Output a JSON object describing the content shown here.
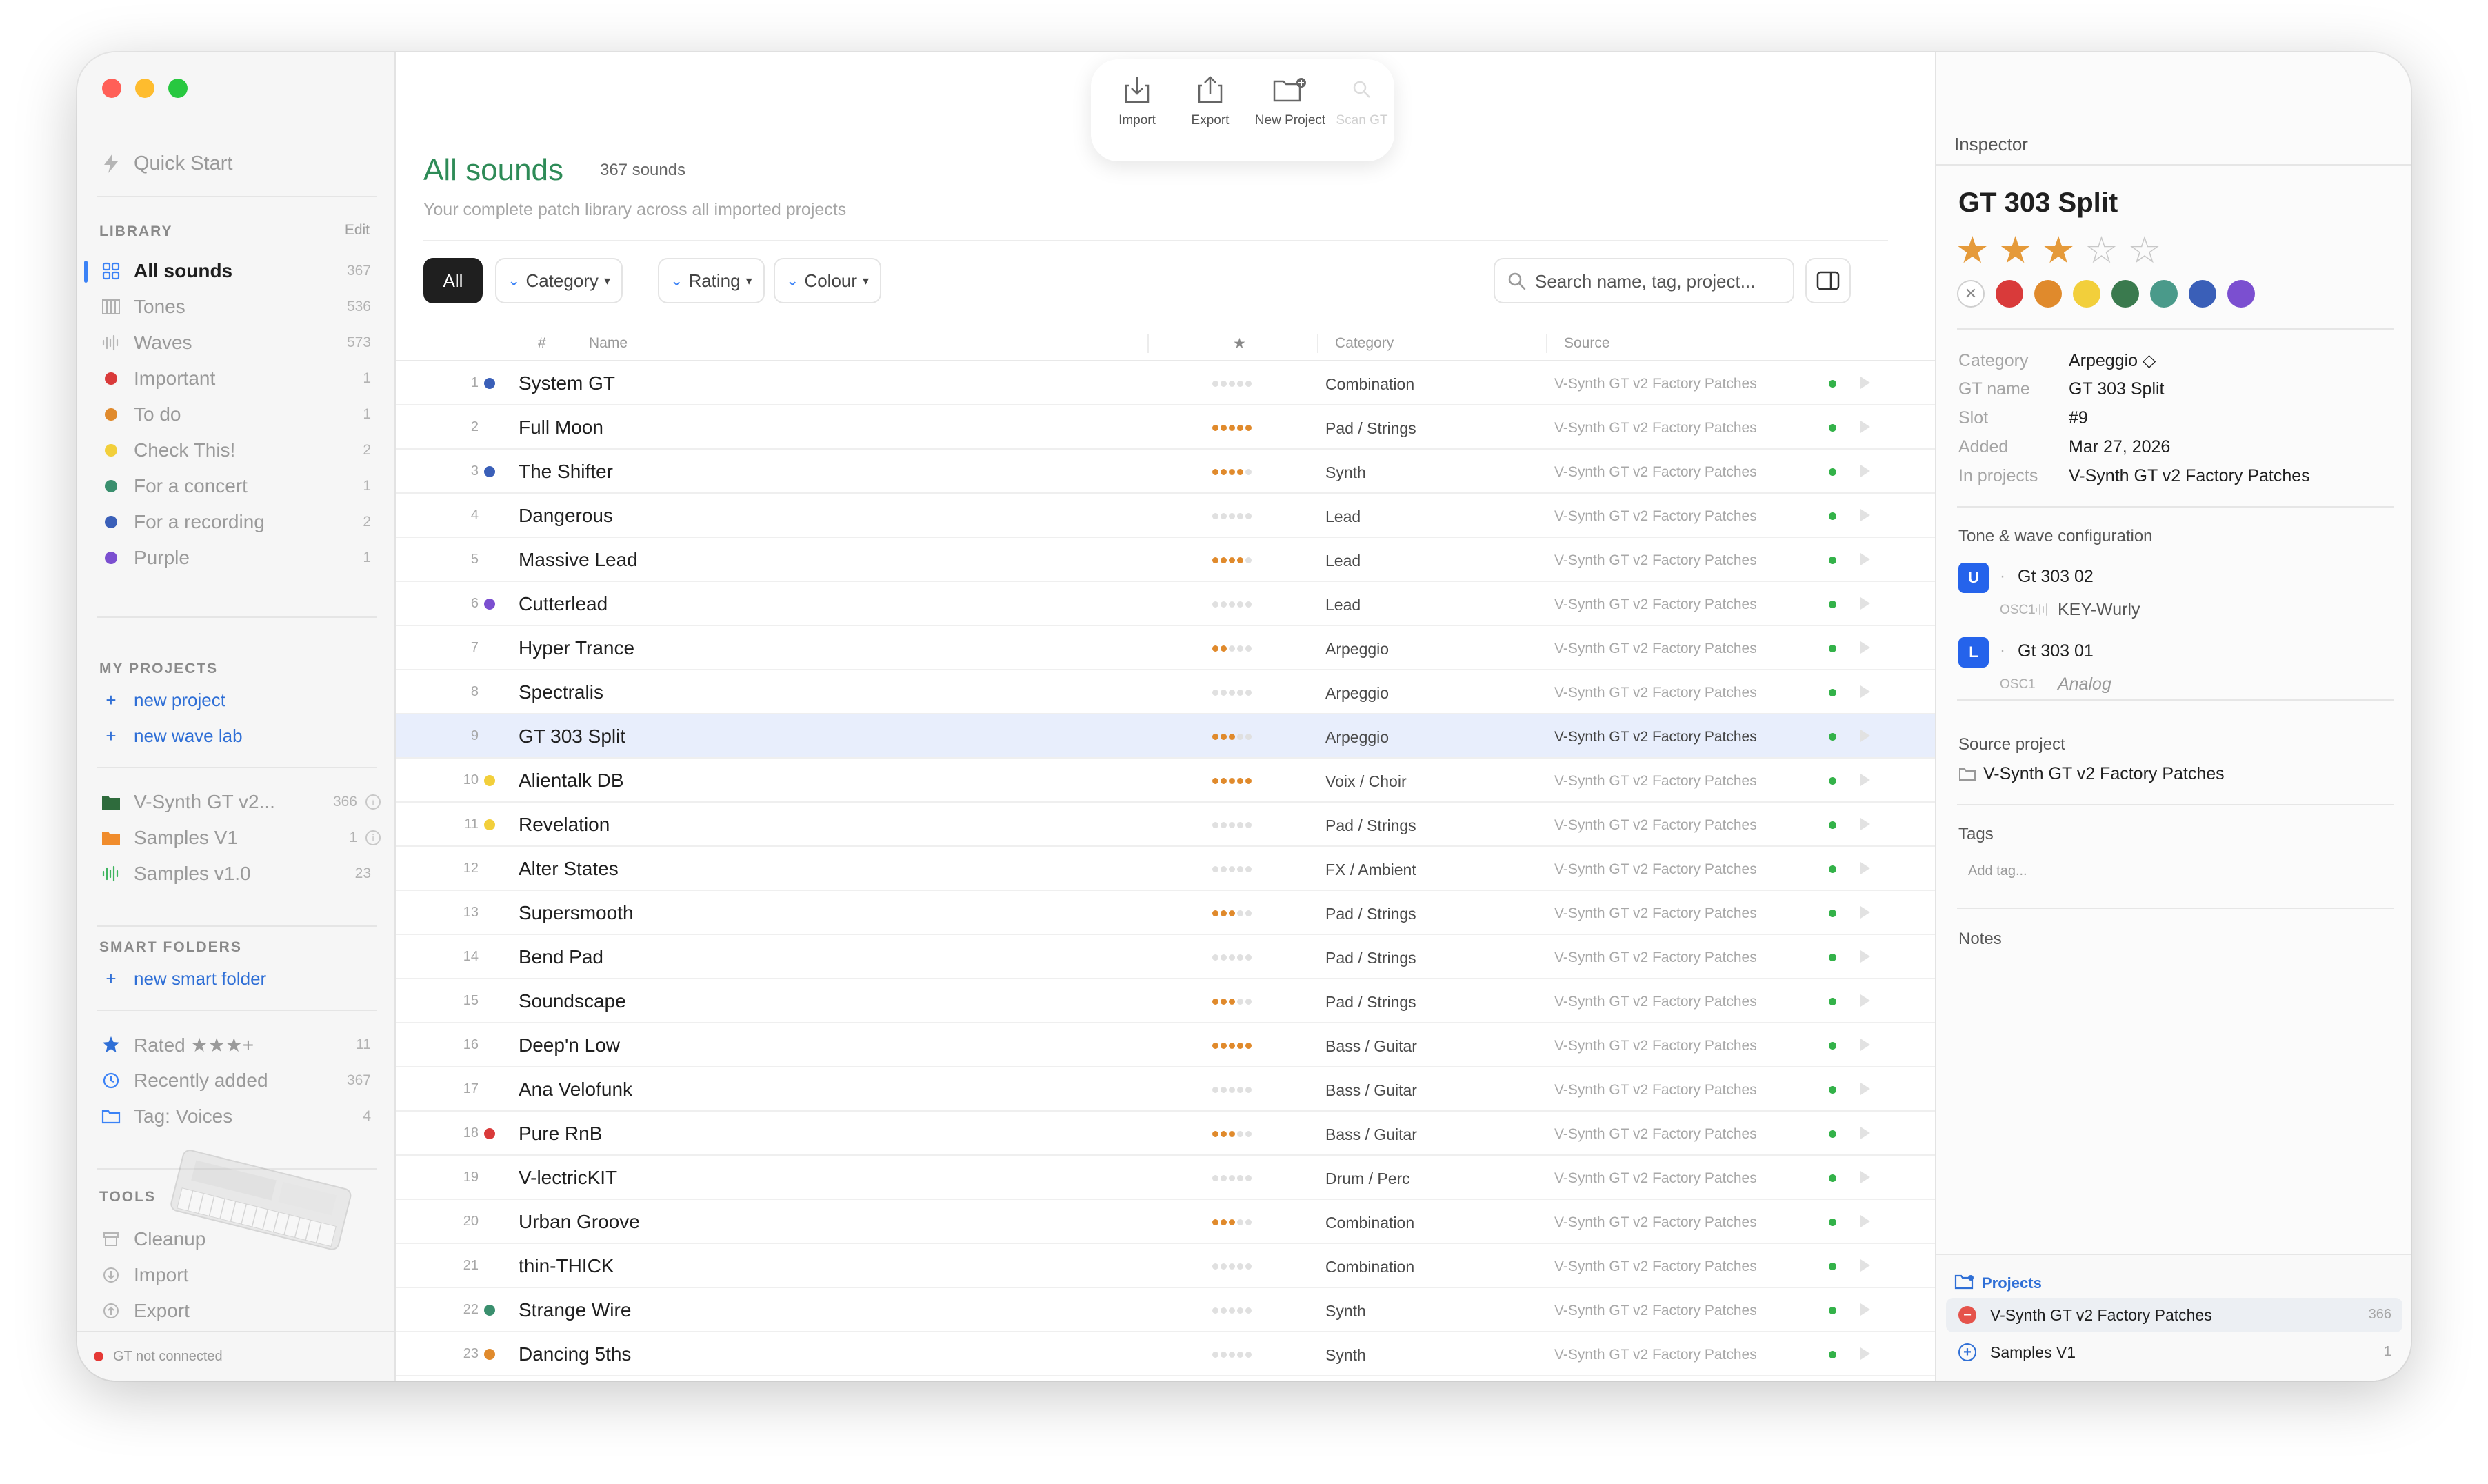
{
  "toolbar": {
    "buttons": [
      {
        "label": "Import",
        "icon": "import-icon"
      },
      {
        "label": "Export",
        "icon": "export-icon"
      },
      {
        "label": "New Project",
        "icon": "new-project-icon"
      },
      {
        "label": "Scan GT",
        "icon": "scan-icon"
      }
    ]
  },
  "sidebar": {
    "quick_start": "Quick Start",
    "library_header": "LIBRARY",
    "library_edit": "Edit",
    "library": [
      {
        "label": "All sounds",
        "count": "367",
        "icon": "grid-icon"
      },
      {
        "label": "Tones",
        "count": "536",
        "icon": "piano-icon"
      },
      {
        "label": "Waves",
        "count": "573",
        "icon": "waveform-icon"
      },
      {
        "label": "Important",
        "count": "1",
        "color": "#d93a3a"
      },
      {
        "label": "To do",
        "count": "1",
        "color": "#e08a2c"
      },
      {
        "label": "Check This!",
        "count": "2",
        "color": "#f2cf3b"
      },
      {
        "label": "For a concert",
        "count": "1",
        "color": "#3a8f6e"
      },
      {
        "label": "For a recording",
        "count": "2",
        "color": "#3a5fb8"
      },
      {
        "label": "Purple",
        "count": "1",
        "color": "#7b4fd0"
      }
    ],
    "projects_header": "MY PROJECTS",
    "new_project": "new project",
    "new_wave_lab": "new wave lab",
    "projects": [
      {
        "label": "V-Synth GT v2...",
        "count": "366",
        "icon": "folder-green-icon"
      },
      {
        "label": "Samples V1",
        "count": "1",
        "icon": "folder-orange-icon"
      },
      {
        "label": "Samples v1.0",
        "count": "23",
        "icon": "waveform-green-icon"
      }
    ],
    "smart_header": "SMART FOLDERS",
    "new_smart_folder": "new smart folder",
    "smart": [
      {
        "label": "Rated ★★★+",
        "count": "11",
        "icon": "star-icon"
      },
      {
        "label": "Recently added",
        "count": "367",
        "icon": "clock-icon"
      },
      {
        "label": "Tag: Voices",
        "count": "4",
        "icon": "folder-icon"
      }
    ],
    "tools_header": "TOOLS",
    "tools": [
      {
        "label": "Cleanup",
        "icon": "cleanup-icon"
      },
      {
        "label": "Import",
        "icon": "import-icon"
      },
      {
        "label": "Export",
        "icon": "export-icon"
      }
    ],
    "status": "GT not connected",
    "status_color": "#e53935"
  },
  "main": {
    "title": "All sounds",
    "count": "367 sounds",
    "subtitle": "Your complete patch library across all imported projects",
    "filter_all": "All",
    "filters": [
      "Category",
      "Rating",
      "Colour"
    ],
    "search_placeholder": "Search name, tag, project...",
    "columns": {
      "num": "#",
      "name": "Name",
      "rating": "★",
      "category": "Category",
      "source": "Source"
    },
    "rows": [
      {
        "num": "1",
        "name": "System GT",
        "color": "#3a5fb8",
        "rating": 0,
        "category": "Combination",
        "source": "V-Synth GT v2 Factory Patches"
      },
      {
        "num": "2",
        "name": "Full Moon",
        "color": "",
        "rating": 5,
        "category": "Pad / Strings",
        "source": "V-Synth GT v2 Factory Patches"
      },
      {
        "num": "3",
        "name": "The Shifter",
        "color": "#3a5fb8",
        "rating": 4,
        "category": "Synth",
        "source": "V-Synth GT v2 Factory Patches"
      },
      {
        "num": "4",
        "name": "Dangerous",
        "color": "",
        "rating": 0,
        "category": "Lead",
        "source": "V-Synth GT v2 Factory Patches"
      },
      {
        "num": "5",
        "name": "Massive Lead",
        "color": "",
        "rating": 4,
        "category": "Lead",
        "source": "V-Synth GT v2 Factory Patches"
      },
      {
        "num": "6",
        "name": "Cutterlead",
        "color": "#7b4fd0",
        "rating": 0,
        "category": "Lead",
        "source": "V-Synth GT v2 Factory Patches"
      },
      {
        "num": "7",
        "name": "Hyper Trance",
        "color": "",
        "rating": 2,
        "category": "Arpeggio",
        "source": "V-Synth GT v2 Factory Patches"
      },
      {
        "num": "8",
        "name": "Spectralis",
        "color": "",
        "rating": 0,
        "category": "Arpeggio",
        "source": "V-Synth GT v2 Factory Patches"
      },
      {
        "num": "9",
        "name": "GT 303 Split",
        "color": "",
        "rating": 3,
        "category": "Arpeggio",
        "source": "V-Synth GT v2 Factory Patches",
        "selected": true
      },
      {
        "num": "10",
        "name": "Alientalk DB",
        "color": "#f2cf3b",
        "rating": 5,
        "category": "Voix / Choir",
        "source": "V-Synth GT v2 Factory Patches"
      },
      {
        "num": "11",
        "name": "Revelation",
        "color": "#f2cf3b",
        "rating": 0,
        "category": "Pad / Strings",
        "source": "V-Synth GT v2 Factory Patches"
      },
      {
        "num": "12",
        "name": "Alter States",
        "color": "",
        "rating": 0,
        "category": "FX / Ambient",
        "source": "V-Synth GT v2 Factory Patches"
      },
      {
        "num": "13",
        "name": "Supersmooth",
        "color": "",
        "rating": 3,
        "category": "Pad / Strings",
        "source": "V-Synth GT v2 Factory Patches"
      },
      {
        "num": "14",
        "name": "Bend Pad",
        "color": "",
        "rating": 0,
        "category": "Pad / Strings",
        "source": "V-Synth GT v2 Factory Patches"
      },
      {
        "num": "15",
        "name": "Soundscape",
        "color": "",
        "rating": 3,
        "category": "Pad / Strings",
        "source": "V-Synth GT v2 Factory Patches"
      },
      {
        "num": "16",
        "name": "Deep'n Low",
        "color": "",
        "rating": 5,
        "category": "Bass / Guitar",
        "source": "V-Synth GT v2 Factory Patches"
      },
      {
        "num": "17",
        "name": "Ana Velofunk",
        "color": "",
        "rating": 0,
        "category": "Bass / Guitar",
        "source": "V-Synth GT v2 Factory Patches"
      },
      {
        "num": "18",
        "name": "Pure RnB",
        "color": "#d93a3a",
        "rating": 3,
        "category": "Bass / Guitar",
        "source": "V-Synth GT v2 Factory Patches"
      },
      {
        "num": "19",
        "name": "V-lectricKIT",
        "color": "",
        "rating": 0,
        "category": "Drum / Perc",
        "source": "V-Synth GT v2 Factory Patches"
      },
      {
        "num": "20",
        "name": "Urban Groove",
        "color": "",
        "rating": 3,
        "category": "Combination",
        "source": "V-Synth GT v2 Factory Patches"
      },
      {
        "num": "21",
        "name": "thin-THICK",
        "color": "",
        "rating": 0,
        "category": "Combination",
        "source": "V-Synth GT v2 Factory Patches"
      },
      {
        "num": "22",
        "name": "Strange Wire",
        "color": "#3a8f6e",
        "rating": 0,
        "category": "Synth",
        "source": "V-Synth GT v2 Factory Patches"
      },
      {
        "num": "23",
        "name": "Dancing 5ths",
        "color": "#e08a2c",
        "rating": 0,
        "category": "Synth",
        "source": "V-Synth GT v2 Factory Patches"
      }
    ]
  },
  "inspector": {
    "header": "Inspector",
    "title": "GT 303 Split",
    "rating": 3,
    "rating_max": 5,
    "swatches": [
      "#d93a3a",
      "#e08a2c",
      "#f2cf3b",
      "#3a7a4e",
      "#4a9a8a",
      "#3a5fb8",
      "#7b4fd0"
    ],
    "fields": [
      {
        "key": "Category",
        "value": "Arpeggio ◇"
      },
      {
        "key": "GT name",
        "value": "GT 303 Split"
      },
      {
        "key": "Slot",
        "value": "#9"
      },
      {
        "key": "Added",
        "value": "Mar 27, 2026"
      },
      {
        "key": "In projects",
        "value": "V-Synth GT v2 Factory Patches"
      }
    ],
    "tone_section": "Tone & wave configuration",
    "tones": [
      {
        "badge": "U",
        "name": "Gt 303 02",
        "osc": "OSC1",
        "wave": "KEY-Wurly",
        "italic": false
      },
      {
        "badge": "L",
        "name": "Gt 303 01",
        "osc": "OSC1",
        "wave": "Analog",
        "italic": true
      }
    ],
    "source_section": "Source project",
    "source_project": "V-Synth GT v2 Factory Patches",
    "tags_section": "Tags",
    "add_tag": "Add tag...",
    "notes_section": "Notes",
    "projects_title": "Projects",
    "projects": [
      {
        "label": "V-Synth GT v2 Factory Patches",
        "count": "366",
        "member": true
      },
      {
        "label": "Samples V1",
        "count": "1",
        "member": false
      }
    ]
  }
}
